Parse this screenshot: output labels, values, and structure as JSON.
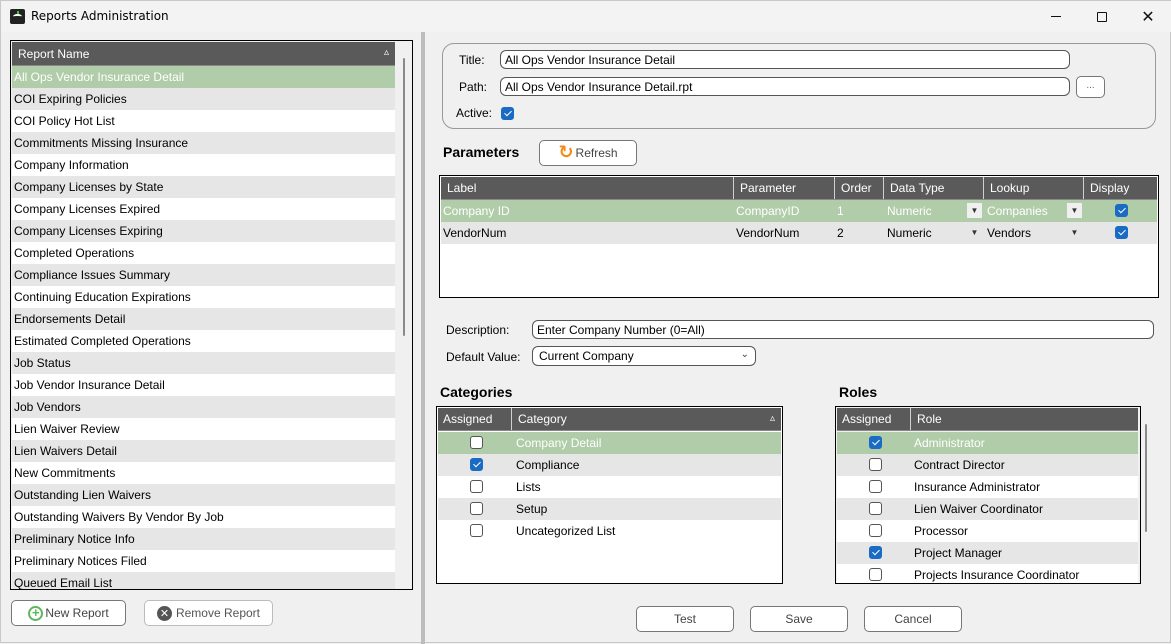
{
  "window": {
    "title": "Reports Administration",
    "controls": {
      "minimize": "minimize",
      "maximize": "maximize",
      "close": "✕"
    }
  },
  "report_list": {
    "header": "Report Name",
    "sort_indicator": "▵",
    "selected_index": 0,
    "items": [
      "All Ops Vendor Insurance Detail",
      "COI Expiring Policies",
      "COI Policy Hot List",
      "Commitments Missing Insurance",
      "Company Information",
      "Company Licenses by State",
      "Company Licenses Expired",
      "Company Licenses Expiring",
      "Completed Operations",
      "Compliance Issues Summary",
      "Continuing Education Expirations",
      "Endorsements Detail",
      "Estimated Completed Operations",
      "Job Status",
      "Job Vendor Insurance Detail",
      "Job Vendors",
      "Lien Waiver Review",
      "Lien Waivers Detail",
      "New Commitments",
      "Outstanding Lien Waivers",
      "Outstanding Waivers By Vendor By Job",
      "Preliminary Notice Info",
      "Preliminary Notices Filed",
      "Queued Email List"
    ],
    "new_report_label": "New Report",
    "remove_report_label": "Remove Report"
  },
  "report_info": {
    "title_label": "Title:",
    "title_value": "All Ops Vendor Insurance Detail",
    "path_label": "Path:",
    "path_value": "All Ops Vendor Insurance Detail.rpt",
    "browse_label": "...",
    "active_label": "Active:",
    "active_checked": true
  },
  "parameters": {
    "section_title": "Parameters",
    "refresh_label": "Refresh",
    "columns": [
      "Label",
      "Parameter",
      "Order",
      "Data Type",
      "Lookup",
      "Display"
    ],
    "rows": [
      {
        "label": "Company ID",
        "parameter": "CompanyID",
        "order": "1",
        "data_type": "Numeric",
        "lookup": "Companies",
        "display": true
      },
      {
        "label": "VendorNum",
        "parameter": "VendorNum",
        "order": "2",
        "data_type": "Numeric",
        "lookup": "Vendors",
        "display": true
      }
    ],
    "description_label": "Description:",
    "description_value": "Enter Company Number (0=All)",
    "default_value_label": "Default Value:",
    "default_value_selected": "Current Company"
  },
  "categories": {
    "section_title": "Categories",
    "columns": [
      "Assigned",
      "Category"
    ],
    "sort_indicator": "▵",
    "rows": [
      {
        "assigned": false,
        "name": "Company Detail"
      },
      {
        "assigned": true,
        "name": "Compliance"
      },
      {
        "assigned": false,
        "name": "Lists"
      },
      {
        "assigned": false,
        "name": "Setup"
      },
      {
        "assigned": false,
        "name": "Uncategorized List"
      }
    ]
  },
  "roles": {
    "section_title": "Roles",
    "columns": [
      "Assigned",
      "Role"
    ],
    "rows": [
      {
        "assigned": true,
        "name": "Administrator"
      },
      {
        "assigned": false,
        "name": "Contract Director"
      },
      {
        "assigned": false,
        "name": "Insurance Administrator"
      },
      {
        "assigned": false,
        "name": "Lien Waiver Coordinator"
      },
      {
        "assigned": false,
        "name": "Processor"
      },
      {
        "assigned": true,
        "name": "Project Manager"
      },
      {
        "assigned": false,
        "name": "Projects Insurance Coordinator"
      }
    ]
  },
  "footer": {
    "test_label": "Test",
    "save_label": "Save",
    "cancel_label": "Cancel"
  },
  "colors": {
    "header_bg": "#5a5a5a",
    "selected_row": "#b0cca8",
    "alt_row": "#e6e6e6",
    "checkbox_on": "#1a6bc4",
    "refresh_icon": "#f28c14",
    "new_icon": "#5cb85c"
  }
}
